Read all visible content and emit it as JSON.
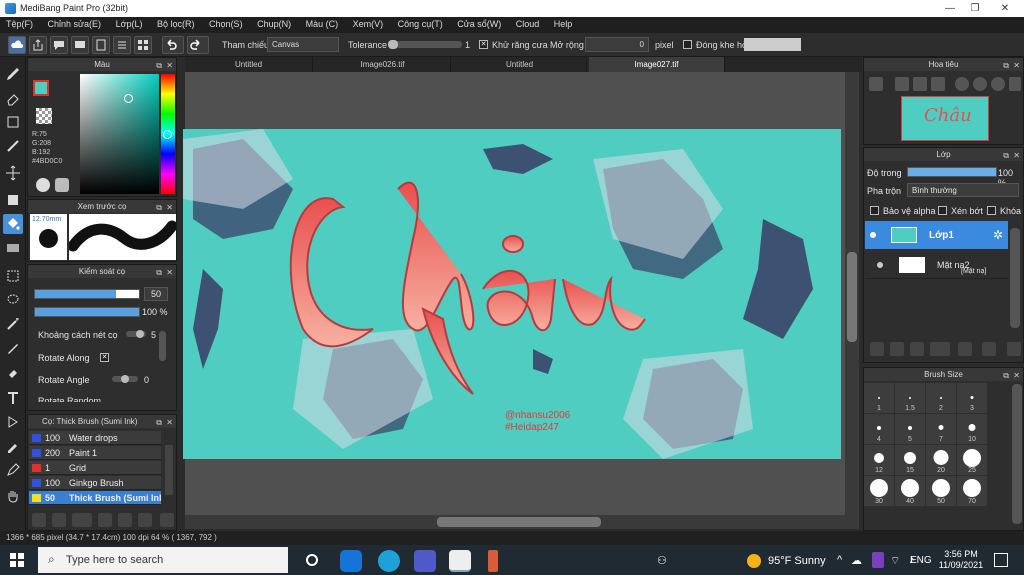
{
  "window": {
    "title": "MediBang Paint Pro (32bit)",
    "controls": [
      "—",
      "❐",
      "✕"
    ]
  },
  "menu": [
    "Tệp(F)",
    "Chỉnh sửa(E)",
    "Lớp(L)",
    "Bộ lọc(R)",
    "Chọn(S)",
    "Chụp(N)",
    "Màu (C)",
    "Xem(V)",
    "Công cụ(T)",
    "Cửa sổ(W)",
    "Cloud",
    "Help"
  ],
  "toolbar": {
    "reference_label": "Tham chiếu",
    "reference_value": "Canvas",
    "tolerance_label": "Tolerance",
    "tolerance_value": "1",
    "antialias_label": "Khử răng cưa",
    "expand_label": "Mở rộng",
    "expand_value": "0",
    "expand_unit": "pixel",
    "close_gap_label": "Đóng khe hở"
  },
  "color_panel": {
    "title": "Màu",
    "r": "R:75",
    "g": "G:208",
    "b": "B:192",
    "hex": "#4BD0C0",
    "fg_color": "#4BD0C0",
    "bg_color": "#e03030"
  },
  "brush_preview": {
    "title": "Xem trước cọ",
    "size": "12.70mm"
  },
  "brush_control": {
    "title": "Kiểm soát cọ",
    "size_value": "50",
    "opacity_value": "100 %",
    "spacing_label": "Khoảng cách nét cọ",
    "spacing_value": "5",
    "rotate_along_label": "Rotate Along",
    "rotate_angle_label": "Rotate Angle",
    "rotate_angle_value": "0",
    "rotate_random_label": "Rotate Random"
  },
  "brush_list": {
    "title": "Cọ: Thick Brush (Sumi Ink)",
    "items": [
      {
        "size": "100",
        "name": "Water drops",
        "color": "#3050e0"
      },
      {
        "size": "200",
        "name": "Paint 1",
        "color": "#3050e0"
      },
      {
        "size": "1",
        "name": "Grid",
        "color": "#e03030"
      },
      {
        "size": "100",
        "name": "Ginkgo Brush",
        "color": "#3050e0"
      },
      {
        "size": "50",
        "name": "Thick Brush (Sumi Ink)",
        "color": "#f0e020"
      }
    ]
  },
  "tabs": [
    "Untitled",
    "Image026.tif",
    "Untitled",
    "Image027.tif"
  ],
  "canvas": {
    "title_text": "Châu",
    "credit_line1": "@nhansu2006",
    "credit_line2": "#Heidap247",
    "background": "#4ecdc0"
  },
  "navigator": {
    "title": "Hoa tiêu"
  },
  "layers": {
    "title": "Lớp",
    "opacity_label": "Độ trong",
    "opacity_value": "100 %",
    "blend_label": "Pha trộn",
    "blend_value": "Bình thường",
    "protect_alpha": "Bảo vệ alpha",
    "clipping": "Xén bớt",
    "lock": "Khóa",
    "items": [
      {
        "name": "Lớp1"
      },
      {
        "name": "Mặt nạ2",
        "tag": "[Mặt nạ]"
      }
    ]
  },
  "brush_size": {
    "title": "Brush Size",
    "sizes": [
      "1",
      "1.5",
      "2",
      "3",
      "4",
      "5",
      "7",
      "10",
      "12",
      "15",
      "20",
      "25",
      "30",
      "40",
      "50",
      "70"
    ]
  },
  "status": {
    "text": "1366 * 685 pixel   (34.7 * 17.4cm)   100 dpi   64 %   ( 1367, 792 )"
  },
  "taskbar": {
    "search_placeholder": "Type here to search",
    "weather": "95°F  Sunny",
    "lang": "ENG",
    "time": "3:56 PM",
    "date": "11/09/2021"
  }
}
